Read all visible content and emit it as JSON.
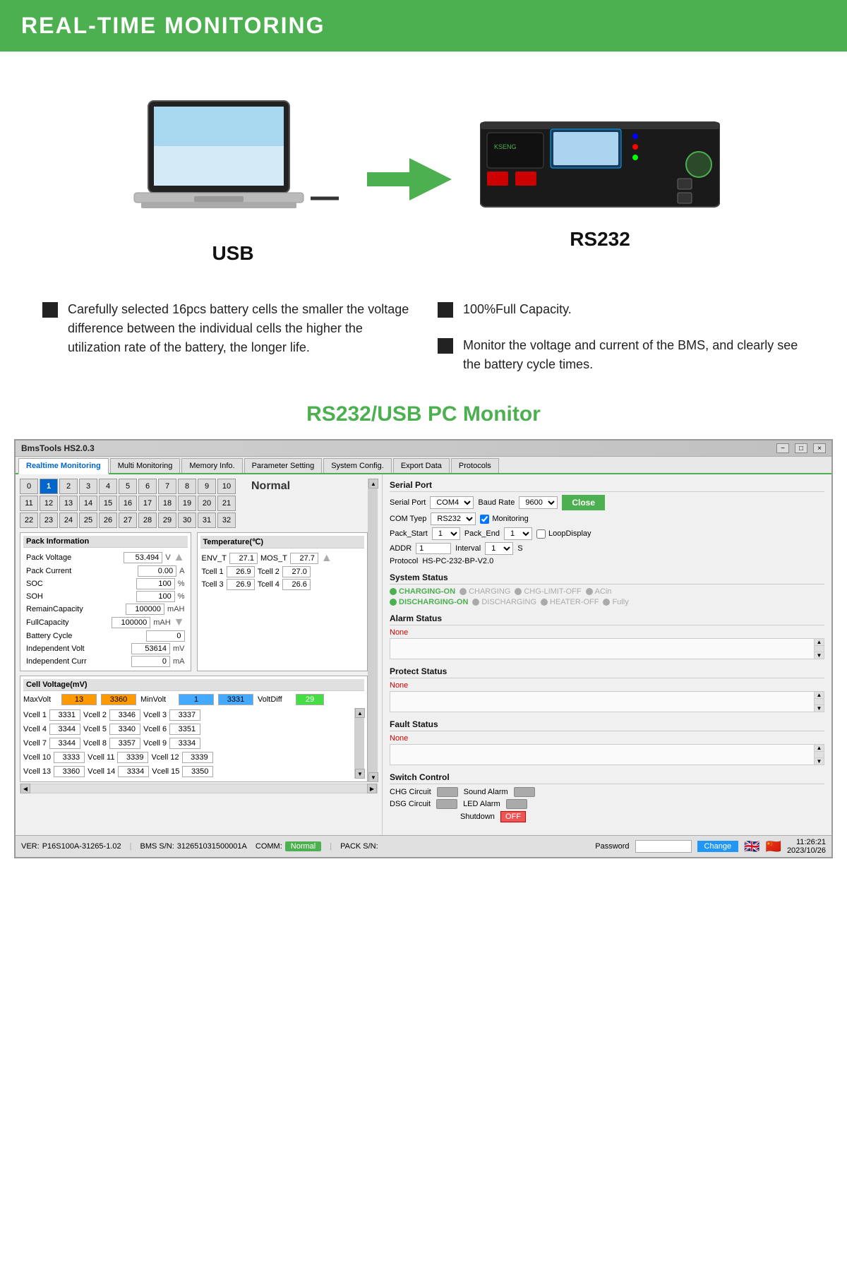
{
  "header": {
    "title": "REAL-TIME MONITORING"
  },
  "hero": {
    "usb_label": "USB",
    "rs232_label": "RS232"
  },
  "features": [
    {
      "text": "Carefully selected 16pcs battery cells the smaller the voltage difference between the individual cells the higher the utilization rate of the battery, the longer life."
    },
    {
      "text": "100%Full Capacity."
    },
    {
      "text": "Monitor the voltage and current of the BMS, and clearly see the battery cycle times."
    }
  ],
  "section_title": "RS232/USB PC Monitor",
  "bms": {
    "title": "BmsTools HS2.0.3",
    "tabs": [
      {
        "label": "Realtime Monitoring",
        "active": true
      },
      {
        "label": "Multi Monitoring"
      },
      {
        "label": "Memory Info."
      },
      {
        "label": "Parameter Setting"
      },
      {
        "label": "System Config."
      },
      {
        "label": "Export Data"
      },
      {
        "label": "Protocols"
      }
    ],
    "cell_grid": {
      "row1": [
        0,
        1,
        2,
        3,
        4,
        5,
        6,
        7,
        8,
        9,
        10
      ],
      "row2": [
        11,
        12,
        13,
        14,
        15,
        16,
        17,
        18,
        19,
        20,
        21
      ],
      "row3": [
        22,
        23,
        24,
        25,
        26,
        27,
        28,
        29,
        30,
        31,
        32
      ],
      "active_cell": 1,
      "normal_label": "Normal"
    },
    "pack_info": {
      "title": "Pack Information",
      "rows": [
        {
          "label": "Pack Voltage",
          "value": "53.494",
          "unit": "V"
        },
        {
          "label": "Pack Current",
          "value": "0.00",
          "unit": "A"
        },
        {
          "label": "SOC",
          "value": "100",
          "unit": "%"
        },
        {
          "label": "SOH",
          "value": "100",
          "unit": "%"
        },
        {
          "label": "RemainCapacity",
          "value": "100000",
          "unit": "mAH"
        },
        {
          "label": "FullCapacity",
          "value": "100000",
          "unit": "mAH"
        },
        {
          "label": "Battery Cycle",
          "value": "0",
          "unit": ""
        },
        {
          "label": "Independent Volt",
          "value": "53614",
          "unit": "mV"
        },
        {
          "label": "Independent Curr",
          "value": "0",
          "unit": "mA"
        }
      ]
    },
    "temperature": {
      "title": "Temperature(℃)",
      "rows": [
        {
          "label": "ENV_T",
          "value": "27.1",
          "label2": "MOS_T",
          "value2": "27.7"
        },
        {
          "label": "Tcell 1",
          "value": "26.9",
          "label2": "Tcell 2",
          "value2": "27.0"
        },
        {
          "label": "Tcell 3",
          "value": "26.9",
          "label2": "Tcell 4",
          "value2": "26.6"
        }
      ]
    },
    "cell_voltage": {
      "title": "Cell Voltage(mV)",
      "max_label": "MaxVolt",
      "max_cell": "13",
      "max_val": "3360",
      "min_label": "MinVolt",
      "min_cell": "1",
      "min_val": "3331",
      "diff_label": "VoltDiff",
      "diff_val": "29",
      "vcells": [
        {
          "label": "Vcell 1",
          "val": "3331"
        },
        {
          "label": "Vcell 2",
          "val": "3346"
        },
        {
          "label": "Vcell 3",
          "val": "3337"
        },
        {
          "label": "Vcell 4",
          "val": "3344"
        },
        {
          "label": "Vcell 5",
          "val": "3340"
        },
        {
          "label": "Vcell 6",
          "val": "3351"
        },
        {
          "label": "Vcell 7",
          "val": "3344"
        },
        {
          "label": "Vcell 8",
          "val": "3357"
        },
        {
          "label": "Vcell 9",
          "val": "3334"
        },
        {
          "label": "Vcell 10",
          "val": "3333"
        },
        {
          "label": "Vcell 11",
          "val": "3339"
        },
        {
          "label": "Vcell 12",
          "val": "3339"
        },
        {
          "label": "Vcell 13",
          "val": "3360"
        },
        {
          "label": "Vcell 14",
          "val": "3334"
        },
        {
          "label": "Vcell 15",
          "val": "3350"
        }
      ]
    },
    "serial_port": {
      "label": "Serial Port",
      "port_label": "Serial Port",
      "port_val": "COM4",
      "baud_label": "Baud Rate",
      "baud_val": "9600",
      "close_btn": "Close",
      "com_type_label": "COM Tyep",
      "com_type_val": "RS232",
      "monitoring_label": "Monitoring",
      "pack_start_label": "Pack_Start",
      "pack_start_val": "1",
      "pack_end_label": "Pack_End",
      "pack_end_val": "1",
      "loop_label": "LoopDisplay",
      "addr_label": "ADDR",
      "addr_val": "1",
      "interval_label": "Interval",
      "interval_val": "1",
      "interval_unit": "S",
      "protocol_label": "Protocol",
      "protocol_val": "HS-PC-232-BP-V2.0"
    },
    "system_status": {
      "label": "System Status",
      "indicators": [
        {
          "label": "CHARGING-ON",
          "active": true,
          "color": "green"
        },
        {
          "label": "CHARGING",
          "active": false,
          "color": "gray"
        },
        {
          "label": "CHG-LIMIT-OFF",
          "active": false,
          "color": "gray"
        },
        {
          "label": "ACin",
          "active": false,
          "color": "gray"
        },
        {
          "label": "DISCHARGING-ON",
          "active": true,
          "color": "green"
        },
        {
          "label": "DISCHARGING",
          "active": false,
          "color": "gray"
        },
        {
          "label": "HEATER-OFF",
          "active": false,
          "color": "gray"
        },
        {
          "label": "Fully",
          "active": false,
          "color": "gray"
        }
      ]
    },
    "alarm_status": {
      "label": "Alarm Status",
      "value": "None"
    },
    "protect_status": {
      "label": "Protect Status",
      "value": "None"
    },
    "fault_status": {
      "label": "Fault Status",
      "value": "None"
    },
    "switch_control": {
      "label": "Switch Control",
      "chg_label": "CHG Circuit",
      "sound_label": "Sound Alarm",
      "dsg_label": "DSG Circuit",
      "led_label": "LED Alarm",
      "shutdown_label": "Shutdown",
      "shutdown_val": "OFF"
    },
    "statusbar": {
      "ver_label": "VER:",
      "ver_val": "P16S100A-31265-1.02",
      "bms_sn_label": "BMS S/N:",
      "bms_sn_val": "312651031500001A",
      "comm_label": "COMM:",
      "comm_val": "Normal",
      "pack_sn_label": "PACK S/N:",
      "pack_sn_val": "",
      "password_label": "Password",
      "change_btn": "Change",
      "time": "11:26:21",
      "date": "2023/10/26"
    }
  }
}
